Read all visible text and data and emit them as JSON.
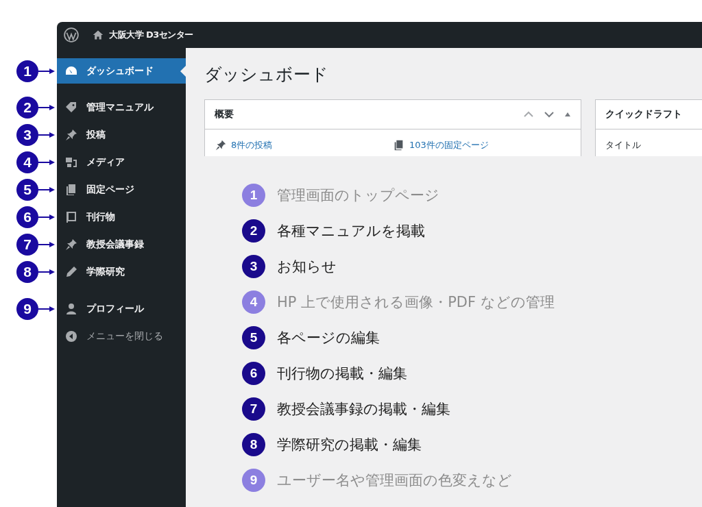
{
  "topbar": {
    "site_name": "大阪大学 D3センター"
  },
  "menu_groups": [
    [
      {
        "label": "ダッシュボード",
        "selected": true,
        "callout": "1"
      }
    ],
    [
      {
        "label": "管理マニュアル",
        "selected": false,
        "callout": "2"
      },
      {
        "label": "投稿",
        "selected": false,
        "callout": "3"
      },
      {
        "label": "メディア",
        "selected": false,
        "callout": "4"
      },
      {
        "label": "固定ページ",
        "selected": false,
        "callout": "5"
      },
      {
        "label": "刊行物",
        "selected": false,
        "callout": "6"
      },
      {
        "label": "教授会議事録",
        "selected": false,
        "callout": "7"
      },
      {
        "label": "学際研究",
        "selected": false,
        "callout": "8"
      }
    ],
    [
      {
        "label": "プロフィール",
        "selected": false,
        "callout": "9"
      }
    ]
  ],
  "collapse_label": "メニューを閉じる",
  "page_title": "ダッシュボード",
  "overview_widget": {
    "title": "概要",
    "links": [
      "8件の投稿",
      "103件の固定ページ"
    ]
  },
  "quick_draft_widget": {
    "title": "クイックドラフト",
    "field_label": "タイトル"
  },
  "legend": [
    {
      "number": "1",
      "text": "管理画面のトップページ",
      "dimmed": true
    },
    {
      "number": "2",
      "text": "各種マニュアルを掲載",
      "dimmed": false
    },
    {
      "number": "3",
      "text": "お知らせ",
      "dimmed": false
    },
    {
      "number": "4",
      "text": "HP 上で使用される画像・PDF などの管理",
      "dimmed": true
    },
    {
      "number": "5",
      "text": "各ページの編集",
      "dimmed": false
    },
    {
      "number": "6",
      "text": "刊行物の掲載・編集",
      "dimmed": false
    },
    {
      "number": "7",
      "text": "教授会議事録の掲載・編集",
      "dimmed": false
    },
    {
      "number": "8",
      "text": "学際研究の掲載・編集",
      "dimmed": false
    },
    {
      "number": "9",
      "text": "ユーザー名や管理画面の色変えなど",
      "dimmed": true
    }
  ]
}
